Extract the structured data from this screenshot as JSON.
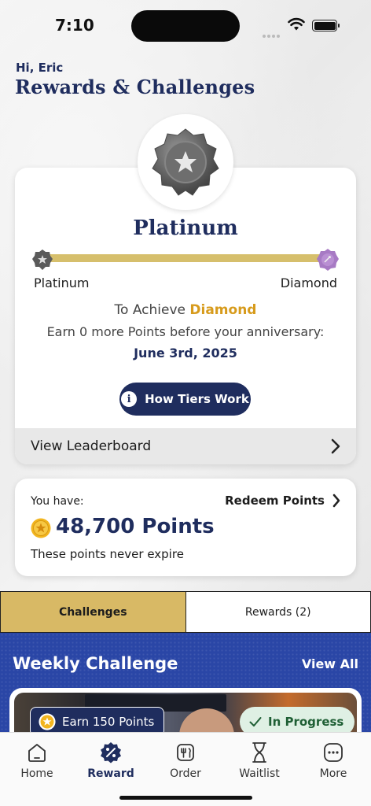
{
  "status_bar": {
    "time": "7:10"
  },
  "header": {
    "greeting": "Hi, Eric",
    "title": "Rewards & Challenges"
  },
  "tier": {
    "current": "Platinum",
    "start_label": "Platinum",
    "end_label": "Diamond",
    "progress": 1.0,
    "achieve_prefix": "To Achieve",
    "achieve_target": "Diamond",
    "earn_text": "Earn 0 more Points before your anniversary:",
    "date": "June 3rd, 2025",
    "how_button": "How Tiers Work",
    "leaderboard_label": "View Leaderboard"
  },
  "points": {
    "you_have": "You have:",
    "redeem_label": "Redeem Points",
    "value": "48,700 Points",
    "note": "These points never expire"
  },
  "tabs": [
    {
      "label": "Challenges",
      "active": true
    },
    {
      "label": "Rewards (2)",
      "active": false
    }
  ],
  "weekly": {
    "title": "Weekly Challenge",
    "view_all": "View All",
    "earn_badge": "Earn 150 Points",
    "status": "In Progress"
  },
  "nav": [
    {
      "label": "Home",
      "icon": "home-icon"
    },
    {
      "label": "Reward",
      "icon": "reward-icon",
      "active": true
    },
    {
      "label": "Order",
      "icon": "order-icon"
    },
    {
      "label": "Waitlist",
      "icon": "waitlist-icon"
    },
    {
      "label": "More",
      "icon": "more-icon"
    }
  ],
  "colors": {
    "navy": "#1f2d5e",
    "gold": "#d8b965",
    "accent_orange": "#d79b1c",
    "weekly_blue": "#2a46a6",
    "progress_green": "#1f5f35"
  }
}
